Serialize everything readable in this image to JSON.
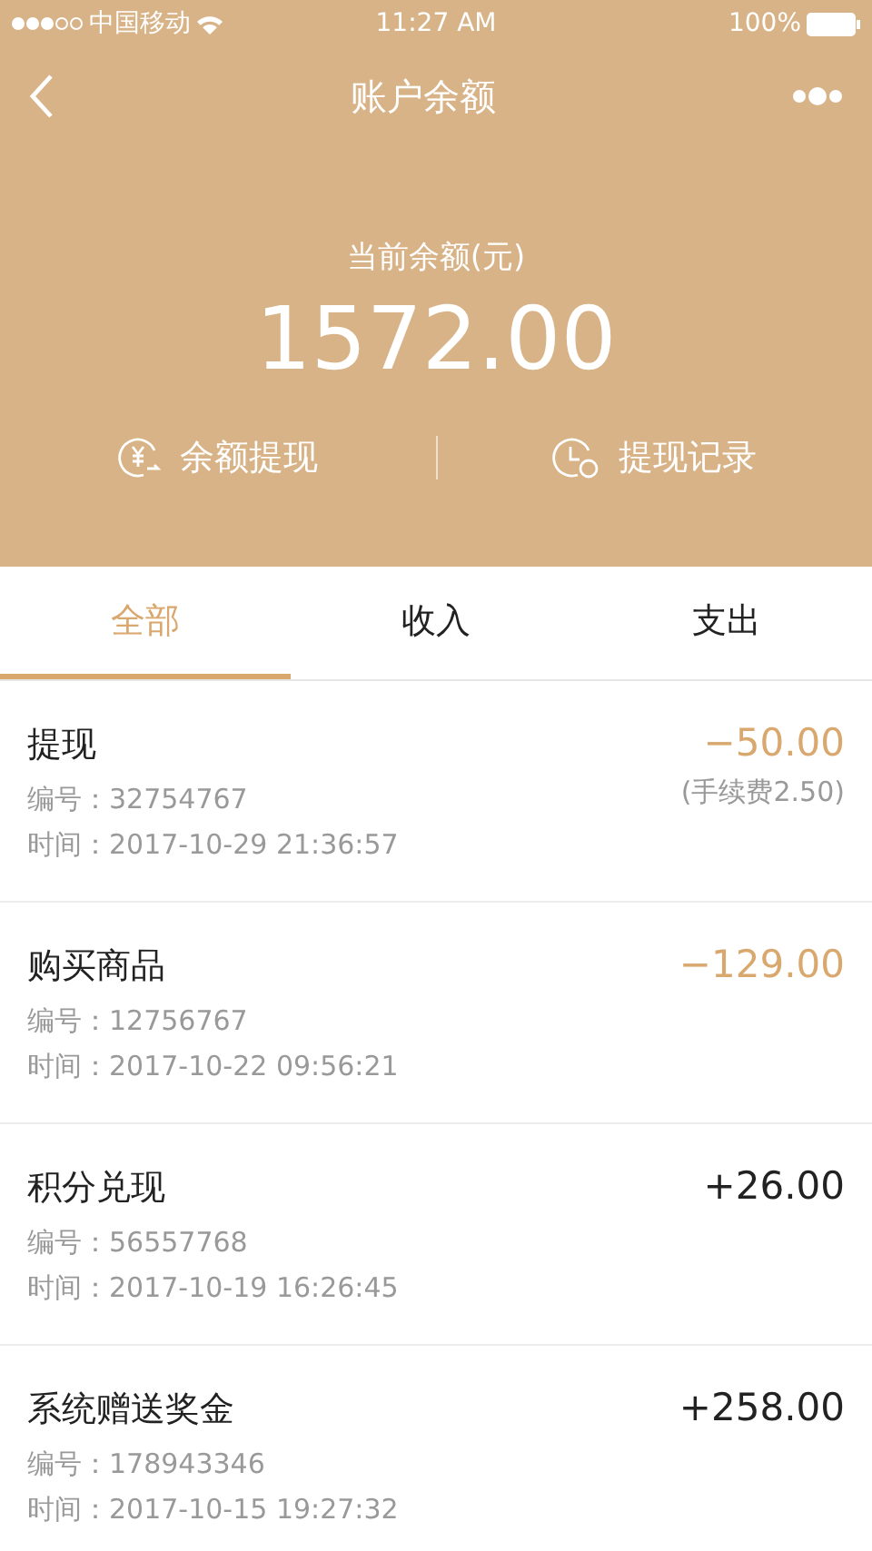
{
  "status_bar": {
    "carrier": "中国移动",
    "time": "11:27 AM",
    "battery": "100%"
  },
  "nav": {
    "title": "账户余额"
  },
  "balance": {
    "label": "当前余额(元)",
    "amount": "1572.00"
  },
  "actions": [
    {
      "kind": "withdraw",
      "label": "余额提现"
    },
    {
      "kind": "history",
      "label": "提现记录"
    }
  ],
  "tabs": [
    {
      "label": "全部",
      "selected": true
    },
    {
      "label": "收入",
      "selected": false
    },
    {
      "label": "支出",
      "selected": false
    }
  ],
  "transactions": [
    {
      "title": "提现",
      "number": "编号：32754767",
      "time": "时间：2017-10-29 21:36:57",
      "amount": "−50.00",
      "kind": "expense",
      "fee": "(手续费2.50)"
    },
    {
      "title": "购买商品",
      "number": "编号：12756767",
      "time": "时间：2017-10-22 09:56:21",
      "amount": "−129.00",
      "kind": "expense"
    },
    {
      "title": "积分兑现",
      "number": "编号：56557768",
      "time": "时间：2017-10-19 16:26:45",
      "amount": "+26.00",
      "kind": "income"
    },
    {
      "title": "系统赠送奖金",
      "number": "编号：178943346",
      "time": "时间：2017-10-15 19:27:32",
      "amount": "+258.00",
      "kind": "income"
    }
  ]
}
